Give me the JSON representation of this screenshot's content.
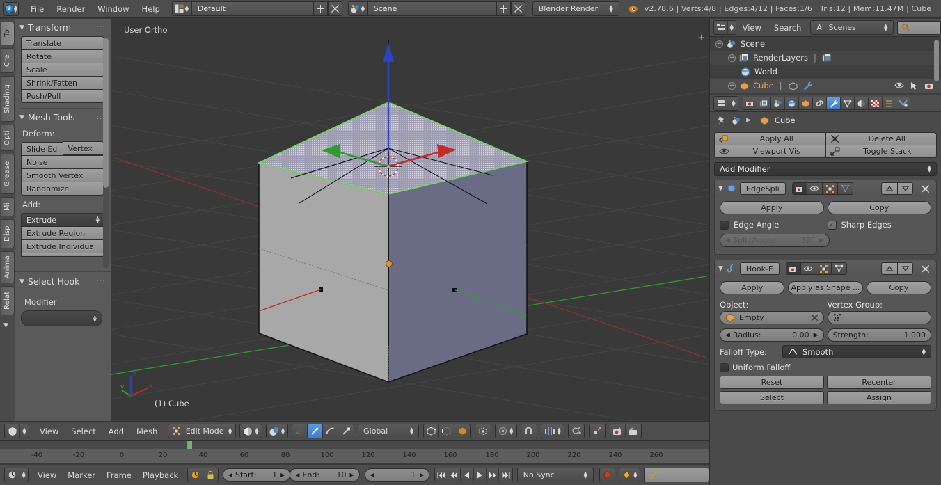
{
  "topbar": {
    "menus": [
      "File",
      "Render",
      "Window",
      "Help"
    ],
    "screen_layout": "Default",
    "scene": "Scene",
    "render_engine": "Blender Render",
    "stats": "v2.78.6 | Verts:4/8 | Edges:4/12 | Faces:1/6 | Tris:12 | Mem:11.47M | Cube",
    "icons": {
      "info": "info-icon",
      "screen": "screen-layout-icon",
      "scene": "scene-icon",
      "add": "add-icon",
      "delete": "delete-x-icon",
      "blender": "blender-logo-icon"
    }
  },
  "toolshelf": {
    "tabs": [
      "To",
      "Cre",
      "Shading",
      "Opti",
      "Grease",
      "Mi",
      "Disp",
      "Anima",
      "Relat"
    ],
    "active_tab": "To",
    "panels": [
      {
        "title": "Transform",
        "buttons": [
          "Translate",
          "Rotate",
          "Scale",
          "Shrink/Fatten",
          "Push/Pull"
        ]
      },
      {
        "title": "Mesh Tools",
        "deform_label": "Deform:",
        "deform_pair": [
          "Slide Ed",
          "Vertex"
        ],
        "deform_buttons": [
          "Noise",
          "Smooth Vertex",
          "Randomize"
        ],
        "add_label": "Add:",
        "add_selected": "Extrude",
        "add_buttons": [
          "Extrude Region",
          "Extrude Individual"
        ]
      }
    ],
    "hook_panel": {
      "title": "Select Hook",
      "field_label": "Modifier",
      "field_value": ""
    }
  },
  "viewport": {
    "view_label": "User Ortho",
    "object_label": "(1) Cube",
    "axis_labels": {
      "x": "x",
      "y": "y",
      "z": "z"
    },
    "colors": {
      "background": "#393939",
      "x_axis": "#c03030",
      "y_axis": "#2f9c2f",
      "z_axis": "#2b45c0",
      "face_select": "#b4b0c4",
      "cube_left": "#a8a8a8",
      "cube_right": "#6a6c86",
      "edge_select": "#79d36a"
    }
  },
  "viewport_footer": {
    "menus": [
      "View",
      "Select",
      "Add",
      "Mesh"
    ],
    "mode": "Edit Mode",
    "transform_orientation": "Global",
    "icons": {
      "editor_type": "editor-type-icon",
      "mode": "edit-mode-icon",
      "shading": "viewport-shading-icon",
      "overlay": "render-shading-icon",
      "vertex_select": "vertex-select-icon",
      "edge_select": "edge-select-icon",
      "face_select": "face-select-icon",
      "manipulator_translate": "translate-manipulator-icon",
      "manipulator_rotate": "rotate-manipulator-icon",
      "manipulator_scale": "scale-manipulator-icon",
      "limit_selection": "limit-selection-icon",
      "occlude": "occlude-geometry-icon",
      "pivot": "pivot-point-icon",
      "snap": "snap-magnet-icon",
      "proportional": "proportional-edit-icon",
      "falloff": "falloff-icon",
      "snap_element": "snap-element-icon",
      "render_view": "render-view-icon",
      "render_animation": "render-animation-icon"
    }
  },
  "outliner": {
    "menus": [
      "View",
      "Search"
    ],
    "display_mode": "All Scenes",
    "search_placeholder": "",
    "rows": [
      {
        "label": "Scene",
        "icon": "scene-icon",
        "depth": 0,
        "expander": "minus"
      },
      {
        "label": "RenderLayers",
        "icon": "renderlayers-icon",
        "depth": 1,
        "expander": "plus"
      },
      {
        "label": "World",
        "icon": "world-icon",
        "depth": 1,
        "expander": ""
      },
      {
        "label": "Cube",
        "icon": "mesh-data-icon",
        "depth": 1,
        "expander": "plus"
      }
    ],
    "row_icons": {
      "eye": "visibility-eye-icon",
      "cursor": "selectable-cursor-icon",
      "camera": "renderability-camera-icon"
    }
  },
  "properties": {
    "tabs": [
      "render-tab-icon",
      "renderlayers-tab-icon",
      "scene-tab-icon",
      "world-tab-icon",
      "object-tab-icon",
      "constraints-tab-icon",
      "modifiers-tab-icon",
      "object-data-tab-icon",
      "material-tab-icon",
      "texture-tab-icon",
      "particles-tab-icon",
      "physics-tab-icon"
    ],
    "active_tab": "modifiers-tab-icon",
    "breadcrumb": "Cube",
    "stack_buttons": {
      "apply_all": "Apply All",
      "delete_all": "Delete All",
      "viewport_vis": "Viewport Vis",
      "toggle_stack": "Toggle Stack"
    },
    "add_modifier": "Add Modifier",
    "modifiers": [
      {
        "name": "EdgeSpli",
        "icon": "edgesplit-modifier-icon",
        "apply": "Apply",
        "copy": "Copy",
        "edge_angle_label": "Edge Angle",
        "edge_angle_checked": false,
        "sharp_edges_label": "Sharp Edges",
        "sharp_edges_checked": true,
        "split_angle_label": "Split Angle:",
        "split_angle_value": "30°",
        "split_angle_disabled": true
      },
      {
        "name": "Hook-E",
        "icon": "hook-modifier-icon",
        "apply": "Apply",
        "apply_as_shape": "Apply as Shape ...",
        "copy": "Copy",
        "object_label": "Object:",
        "object_value": "Empty",
        "vertex_group_label": "Vertex Group:",
        "vertex_group_value": "",
        "radius_label": "Radius:",
        "radius_value": "0.00",
        "strength_label": "Strength:",
        "strength_value": "1.000",
        "falloff_type_label": "Falloff Type:",
        "falloff_type_value": "Smooth",
        "uniform_falloff_label": "Uniform Falloff",
        "uniform_falloff_checked": false,
        "reset": "Reset",
        "recenter": "Recenter",
        "select": "Select",
        "assign": "Assign"
      }
    ]
  },
  "timeline": {
    "ticks": [
      "-40",
      "-20",
      "0",
      "20",
      "40",
      "60",
      "80",
      "100",
      "120",
      "140",
      "160",
      "180",
      "200",
      "220",
      "240",
      "260"
    ],
    "menus": [
      "View",
      "Marker",
      "Frame",
      "Playback"
    ],
    "start_label": "Start:",
    "start_value": "1",
    "end_label": "End:",
    "end_value": "10",
    "current_frame": "1",
    "sync_mode": "No Sync",
    "icons": {
      "editor_type": "timeline-editor-icon",
      "auto_key": "auto-keyframe-icon",
      "lock": "lock-icon",
      "jump_start": "jump-to-start-icon",
      "prev_keyframe": "previous-keyframe-icon",
      "play_reverse": "play-reverse-icon",
      "play": "play-icon",
      "next_keyframe": "next-keyframe-icon",
      "jump_end": "jump-to-end-icon",
      "record": "record-icon",
      "keyframe_type": "keyframe-type-icon",
      "keying_set": "keying-set-icon"
    }
  }
}
